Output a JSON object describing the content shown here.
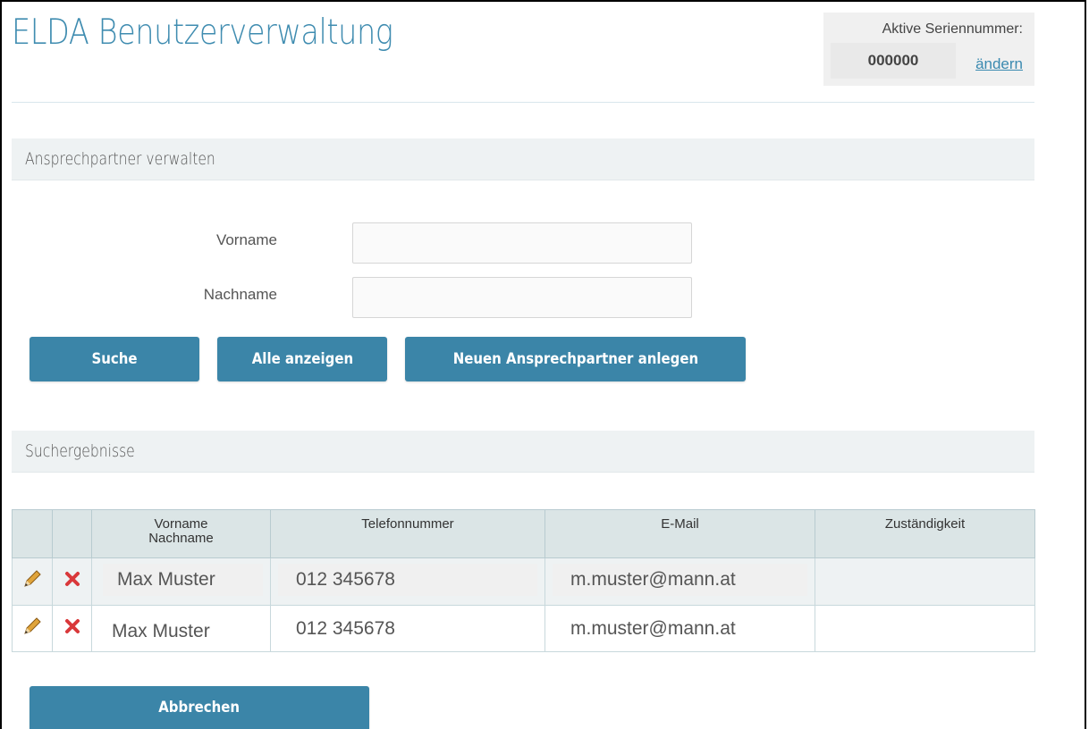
{
  "header": {
    "title": "ELDA Benutzerverwaltung",
    "serial_label": "Aktive Seriennummer:",
    "serial_value": "000000",
    "serial_change_link": "ändern"
  },
  "manage_section": {
    "title": "Ansprechpartner verwalten",
    "fields": {
      "firstname_label": "Vorname",
      "firstname_value": "",
      "lastname_label": "Nachname",
      "lastname_value": ""
    },
    "buttons": {
      "search": "Suche",
      "show_all": "Alle anzeigen",
      "create_new": "Neuen Ansprechpartner anlegen"
    }
  },
  "results_section": {
    "title": "Suchergebnisse",
    "columns": {
      "name_line1": "Vorname",
      "name_line2": "Nachname",
      "phone": "Telefonnummer",
      "email": "E-Mail",
      "responsibility": "Zuständigkeit"
    },
    "rows": [
      {
        "name": "Max Muster",
        "phone": "012 345678",
        "email": "m.muster@mann.at",
        "responsibility": ""
      },
      {
        "name": "Max Muster",
        "phone": "012 345678",
        "email": "m.muster@mann.at",
        "responsibility": ""
      }
    ]
  },
  "footer": {
    "cancel": "Abbrechen"
  },
  "icons": {
    "edit": "pencil-icon",
    "delete": "delete-x-icon"
  },
  "colors": {
    "accent": "#3b85a8",
    "title": "#3f8cb0",
    "delete": "#d9383a"
  }
}
